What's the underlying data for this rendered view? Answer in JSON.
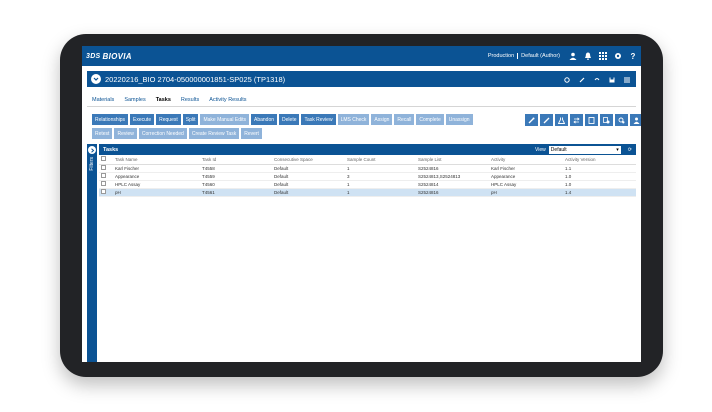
{
  "app": {
    "logo_prefix": "3DS",
    "logo_text": "BIOVIA"
  },
  "env": {
    "env_label": "Production",
    "role_label": "Default (Author)"
  },
  "title": "20220216_BIO 2704-050000001851-SP025 (TP1318)",
  "tabs": [
    {
      "label": "Materials",
      "active": false
    },
    {
      "label": "Samples",
      "active": false
    },
    {
      "label": "Tasks",
      "active": true
    },
    {
      "label": "Results",
      "active": false
    },
    {
      "label": "Activity Results",
      "active": false
    }
  ],
  "actions_row1": [
    {
      "label": "Relationships",
      "enabled": true
    },
    {
      "label": "Execute",
      "enabled": true
    },
    {
      "label": "Request",
      "enabled": true
    },
    {
      "label": "Split",
      "enabled": true
    },
    {
      "label": "Make Manual Edits",
      "enabled": false
    },
    {
      "label": "Abandon",
      "enabled": true
    },
    {
      "label": "Delete",
      "enabled": true
    },
    {
      "label": "Task Review",
      "enabled": true
    },
    {
      "label": "LMS Check",
      "enabled": false
    },
    {
      "label": "Assign",
      "enabled": false
    },
    {
      "label": "Recall",
      "enabled": false
    },
    {
      "label": "Complete",
      "enabled": false
    },
    {
      "label": "Unassign",
      "enabled": false
    }
  ],
  "actions_row2": [
    {
      "label": "Retest",
      "enabled": false
    },
    {
      "label": "Review",
      "enabled": false
    },
    {
      "label": "Correction Needed",
      "enabled": false
    },
    {
      "label": "Create Review Task",
      "enabled": false
    },
    {
      "label": "Revert",
      "enabled": false
    }
  ],
  "panel": {
    "title": "Tasks",
    "view_label": "View",
    "view_value": "Default",
    "filters_label": "Filters"
  },
  "table": {
    "columns": [
      "Task Name",
      "Task Id",
      "Consecutive Space",
      "Sample Count",
      "Sample List",
      "Activity",
      "Activity Version"
    ],
    "rows": [
      {
        "name": "Karl Fischer",
        "id": "T4558",
        "space": "Default",
        "count": "1",
        "list": "S2524816",
        "activity": "Karl Fischer",
        "version": "1.1",
        "selected": false
      },
      {
        "name": "Appearance",
        "id": "T4559",
        "space": "Default",
        "count": "3",
        "list": "S2524813,S2524813",
        "activity": "Appearance",
        "version": "1.0",
        "selected": false
      },
      {
        "name": "HPLC Assay",
        "id": "T4560",
        "space": "Default",
        "count": "1",
        "list": "S2524814",
        "activity": "HPLC Assay",
        "version": "1.0",
        "selected": false
      },
      {
        "name": "pH",
        "id": "T4561",
        "space": "Default",
        "count": "1",
        "list": "S2524816",
        "activity": "pH",
        "version": "1.4",
        "selected": true
      }
    ]
  },
  "colors": {
    "brand": "#0b5394",
    "button": "#3b79b8",
    "button_disabled": "#8fb3da",
    "selected_row": "#cfe2f3"
  }
}
